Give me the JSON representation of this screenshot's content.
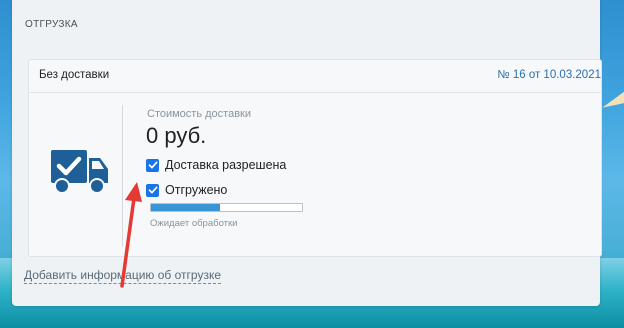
{
  "section": {
    "title": "ОТГРУЗКА"
  },
  "card": {
    "title": "Без доставки",
    "number": "№ 16 от 10.03.2021"
  },
  "delivery": {
    "cost_label": "Стоимость доставки",
    "cost_value": "0 руб.",
    "allowed_label": "Доставка разрешена",
    "allowed_checked": true,
    "shipped_label": "Отгружено",
    "shipped_checked": true,
    "progress_fraction": 0.46,
    "progress_label": "Ожидает обработки"
  },
  "add_info_link": "Добавить информацию об отгрузке",
  "colors": {
    "accent": "#1a73e8",
    "icon": "#1f5f97",
    "arrow": "#e53935"
  },
  "icons": {
    "truck": "truck-check-icon",
    "checkbox": "check-icon"
  }
}
